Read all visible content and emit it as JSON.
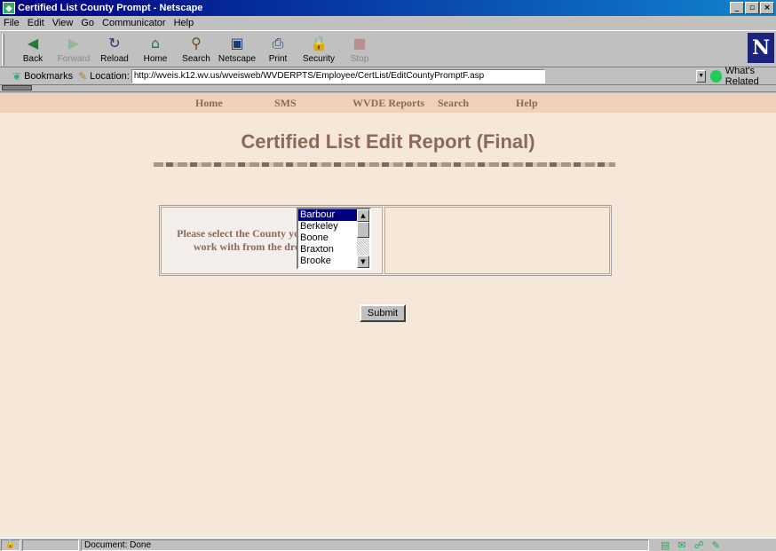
{
  "window": {
    "title": "Certified List County Prompt - Netscape",
    "icon": "netscape-icon"
  },
  "window_buttons": [
    "_",
    "▫",
    "×"
  ],
  "menu": [
    "File",
    "Edit",
    "View",
    "Go",
    "Communicator",
    "Help"
  ],
  "toolbar": [
    {
      "label": "Back",
      "icon": "back-icon",
      "glyph": "◀",
      "enabled": true
    },
    {
      "label": "Forward",
      "icon": "forward-icon",
      "glyph": "▶",
      "enabled": false
    },
    {
      "label": "Reload",
      "icon": "reload-icon",
      "glyph": "↻",
      "enabled": true
    },
    {
      "label": "Home",
      "icon": "home-icon",
      "glyph": "⌂",
      "enabled": true
    },
    {
      "label": "Search",
      "icon": "search-icon",
      "glyph": "⚲",
      "enabled": true
    },
    {
      "label": "Netscape",
      "icon": "netscape-guide-icon",
      "glyph": "▣",
      "enabled": true
    },
    {
      "label": "Print",
      "icon": "print-icon",
      "glyph": "⎙",
      "enabled": true
    },
    {
      "label": "Security",
      "icon": "security-lock-icon",
      "glyph": "🔒",
      "enabled": true
    },
    {
      "label": "Stop",
      "icon": "stop-icon",
      "glyph": "■",
      "enabled": false
    }
  ],
  "logo": "N",
  "location": {
    "bookmarks_label": "Bookmarks",
    "location_label": "Location:",
    "url": "http://wveis.k12.wv.us/wveisweb/WVDERPTS/Employee/CertList/EditCountyPromptF.asp",
    "related_label": "What's Related"
  },
  "nav": [
    "Home",
    "SMS",
    "WVDE Reports",
    "Search",
    "Help"
  ],
  "page": {
    "title": "Certified List Edit Report (Final)",
    "prompt_text": "Please select the County you would like to work with from the drop down list",
    "counties": [
      "Barbour",
      "Berkeley",
      "Boone",
      "Braxton",
      "Brooke"
    ],
    "selected_county": "Barbour",
    "submit_label": "Submit"
  },
  "status": {
    "message": "Document: Done"
  }
}
